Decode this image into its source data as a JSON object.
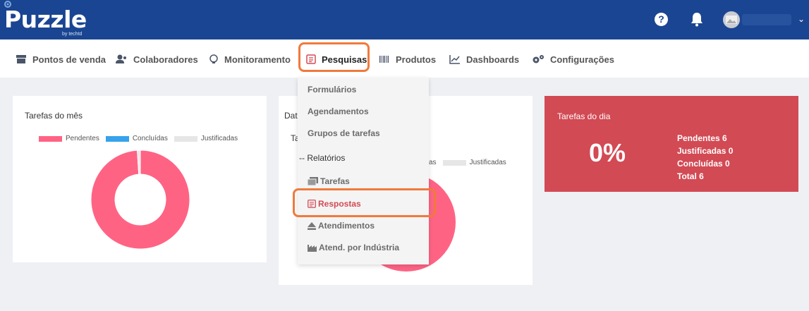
{
  "app": {
    "logo_text": "Puzzle",
    "logo_sub": "by techtd"
  },
  "nav": {
    "items": [
      {
        "label": "Pontos de venda",
        "icon": "store-icon"
      },
      {
        "label": "Colaboradores",
        "icon": "users-icon"
      },
      {
        "label": "Monitoramento",
        "icon": "bulb-icon"
      },
      {
        "label": "Pesquisas",
        "icon": "clipboard-icon"
      },
      {
        "label": "Produtos",
        "icon": "barcode-icon"
      },
      {
        "label": "Dashboards",
        "icon": "chart-line-icon"
      },
      {
        "label": "Configurações",
        "icon": "gears-icon"
      }
    ]
  },
  "dropdown": {
    "items": [
      {
        "label": "Formulários"
      },
      {
        "label": "Agendamentos"
      },
      {
        "label": "Grupos de tarefas"
      },
      {
        "label": "-- Relatórios"
      },
      {
        "label": "Tarefas",
        "icon": "tasks-icon"
      },
      {
        "label": "Respostas",
        "icon": "clipboard-icon"
      },
      {
        "label": "Atendimentos",
        "icon": "eject-icon"
      },
      {
        "label": "Atend. por Indústria",
        "icon": "industry-icon"
      }
    ]
  },
  "cards": {
    "month": {
      "title": "Tarefas do mês",
      "legend": [
        "Pendentes",
        "Concluídas",
        "Justificadas"
      ]
    },
    "date": {
      "title": "Dat",
      "subtitle": "Ta",
      "legend_partial": "as",
      "legend_last": "Justificadas"
    },
    "day": {
      "title": "Tarefas do dia",
      "percent": "0%",
      "stats": [
        "Pendentes 6",
        "Justificadas 0",
        "Concluídas 0",
        "Total 6"
      ]
    }
  },
  "colors": {
    "topbar": "#1a4592",
    "pendentes": "#ff6384",
    "concluidas": "#36a2eb",
    "justificadas": "#e6e6e6",
    "day_card": "#d24a54",
    "highlight": "#f07a3c"
  },
  "chart_data": [
    {
      "type": "pie",
      "title": "Tarefas do mês",
      "categories": [
        "Pendentes",
        "Concluídas",
        "Justificadas"
      ],
      "values": [
        99,
        0,
        1
      ]
    }
  ]
}
